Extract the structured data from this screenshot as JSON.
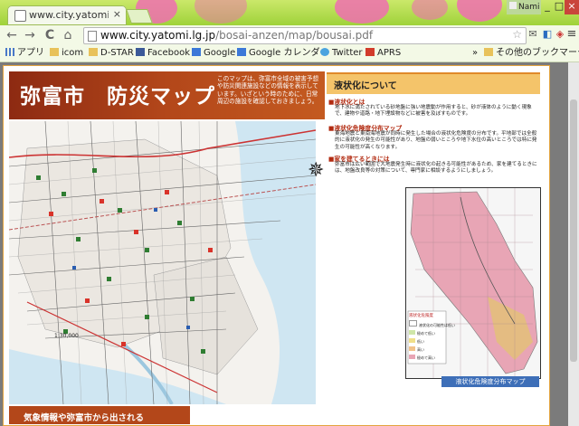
{
  "browser": {
    "tab_title": "www.city.yatomi.lg.jp/bo",
    "tab_close": "×",
    "user": "Nami",
    "win_min": "_",
    "win_max": "□",
    "win_close": "×",
    "nav_back": "←",
    "nav_forward": "→",
    "nav_reload": "C",
    "nav_home": "⌂",
    "url_host": "www.city.yatomi.lg.jp",
    "url_path": "/bosai-anzen/map/bousai.pdf",
    "star": "☆",
    "menu": "≡"
  },
  "bookmarks": {
    "apps": "アプリ",
    "items": [
      "icom",
      "D-STAR",
      "Facebook",
      "Google",
      "Google カレンダー",
      "Twitter",
      "APRS"
    ],
    "more": "»",
    "other": "その他のブックマーク"
  },
  "document": {
    "title": "弥富市　防災マップ",
    "header_desc": "このマップは、弥富市全域の被害予想や防災関連施設などの情報を表示しています。いざという時のために、日常周辺の施設を確認しておきましょう。",
    "side_heading": "液状化について",
    "sections": [
      {
        "title": "■液状化とは",
        "text": "地下水に満たされている砂地盤に強い地震動が作用すると、砂が液体のように動く現象で、建物や道路・地下埋設物などに被害を及ぼすものです。"
      },
      {
        "title": "■液状化危険度分布マップ",
        "text": "東海地震と東南海地震が同時に発生した場合の液状化危険度の分布です。平地部では全般的に液状化の発生の可能性があり、地盤の弱いところや地下水位の高いところでは特に発生の可能性が高くなります。"
      },
      {
        "title": "■家を建てるときには",
        "text": "弥富市は広い範囲で大地震発生時に液状化の起きる可能性があるため、家を建てるときには、地盤改良等の対策について、専門家に相談するようにしましょう。"
      }
    ],
    "map_caption": "液状化危険度分布マップ",
    "legend_title": "液状化危険度",
    "legend": [
      "液状化の可能性は低い",
      "極めて低い",
      "低い",
      "高い",
      "極めて高い"
    ],
    "scale": "1:30,000",
    "bottom_heading": "気象情報や弥富市から出される"
  },
  "colors": {
    "accent": "#b3471a",
    "header_dark": "#8d2a12",
    "tab_green": "#9fd23a",
    "liquefaction_pink": "#e8a5b5"
  }
}
